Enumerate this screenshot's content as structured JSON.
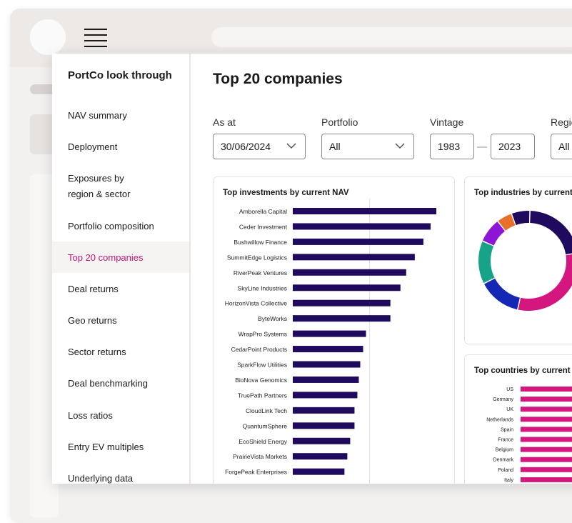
{
  "sidebar": {
    "title": "PortCo look through",
    "items": [
      {
        "label": "NAV summary"
      },
      {
        "label": "Deployment"
      },
      {
        "label": "Exposures by",
        "label2": "region & sector"
      },
      {
        "label": "Portfolio composition"
      },
      {
        "label": "Top 20 companies",
        "active": true
      },
      {
        "label": "Deal returns"
      },
      {
        "label": "Geo returns"
      },
      {
        "label": "Sector returns"
      },
      {
        "label": "Deal benchmarking"
      },
      {
        "label": "Loss ratios"
      },
      {
        "label": "Entry EV multiples"
      },
      {
        "label": "Underlying data"
      }
    ]
  },
  "main": {
    "title": "Top 20 companies",
    "filters": {
      "as_at_label": "As at",
      "as_at_value": "30/06/2024",
      "portfolio_label": "Portfolio",
      "portfolio_value": "All",
      "vintage_label": "Vintage",
      "vintage_from": "1983",
      "vintage_to": "2023",
      "region_label": "Regio",
      "region_value": "All"
    }
  },
  "colors": {
    "accent": "#c4167a",
    "bar_navy": "#1f0a5e",
    "bar_magenta": "#d4167f"
  },
  "chart_data": [
    {
      "type": "bar",
      "orientation": "horizontal",
      "title": "Top investments by current NAV",
      "categories": [
        "Amborella Capital",
        "Ceder Investment",
        "Bushwillow Finance",
        "SummitEdge Logistics",
        "RiverPeak Ventures",
        "SkyLine Industries",
        "HorizonVista Collective",
        "ByteWorks",
        "WrapPro Systems",
        "CedarPoint Products",
        "SparkFlow Utilities",
        "BioNova Genomics",
        "TruePath Partners",
        "CloudLink Tech",
        "QuantumSphere",
        "EcoShield Energy",
        "PrairieVista Markets",
        "ForgePeak Enterprises"
      ],
      "values": [
        100,
        96,
        91,
        85,
        79,
        75,
        68,
        68,
        51,
        49,
        47,
        46,
        45,
        43,
        43,
        40,
        38,
        36
      ],
      "xlim": [
        0,
        100
      ],
      "grid": true
    },
    {
      "type": "pie",
      "donut": true,
      "title": "Top industries by current",
      "slices": [
        {
          "value": 22,
          "color": "#1f0a5e"
        },
        {
          "value": 31,
          "color": "#d4167f"
        },
        {
          "value": 14,
          "color": "#1428b4"
        },
        {
          "value": 14,
          "color": "#16a38a"
        },
        {
          "value": 8,
          "color": "#8c16d4"
        },
        {
          "value": 5,
          "color": "#e8702a"
        },
        {
          "value": 6,
          "color": "#1f0a5e"
        }
      ]
    },
    {
      "type": "bar",
      "orientation": "horizontal",
      "title": "Top countries by current",
      "categories": [
        "US",
        "Germany",
        "UK",
        "Netherlands",
        "Spain",
        "France",
        "Belgium",
        "Denmark",
        "Poland",
        "Italy"
      ],
      "values": [
        100,
        96,
        92,
        88,
        84,
        80,
        76,
        72,
        68,
        64
      ],
      "xlim": [
        0,
        100
      ]
    }
  ]
}
